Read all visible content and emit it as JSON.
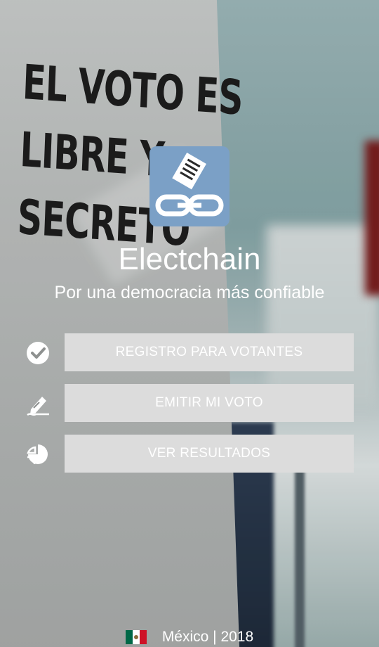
{
  "background": {
    "sign_lines": [
      "EL VOTO ES",
      "LIBRE Y",
      "SECRETO"
    ]
  },
  "app": {
    "title": "Electchain",
    "tagline": "Por una democracia más confiable",
    "logo_icon": "ballot-chain-icon",
    "logo_color": "#7ba0c6"
  },
  "menu": [
    {
      "label": "REGISTRO PARA VOTANTES",
      "icon": "check-circle-icon"
    },
    {
      "label": "EMITIR MI VOTO",
      "icon": "pen-sign-icon"
    },
    {
      "label": "VER RESULTADOS",
      "icon": "pie-chart-icon"
    }
  ],
  "footer": {
    "flag_icon": "mexico-flag-icon",
    "text": "México | 2018"
  },
  "colors": {
    "button_bg": "#dcdcdc",
    "text": "#ffffff",
    "flag": [
      "#006847",
      "#ffffff",
      "#ce1126"
    ]
  }
}
